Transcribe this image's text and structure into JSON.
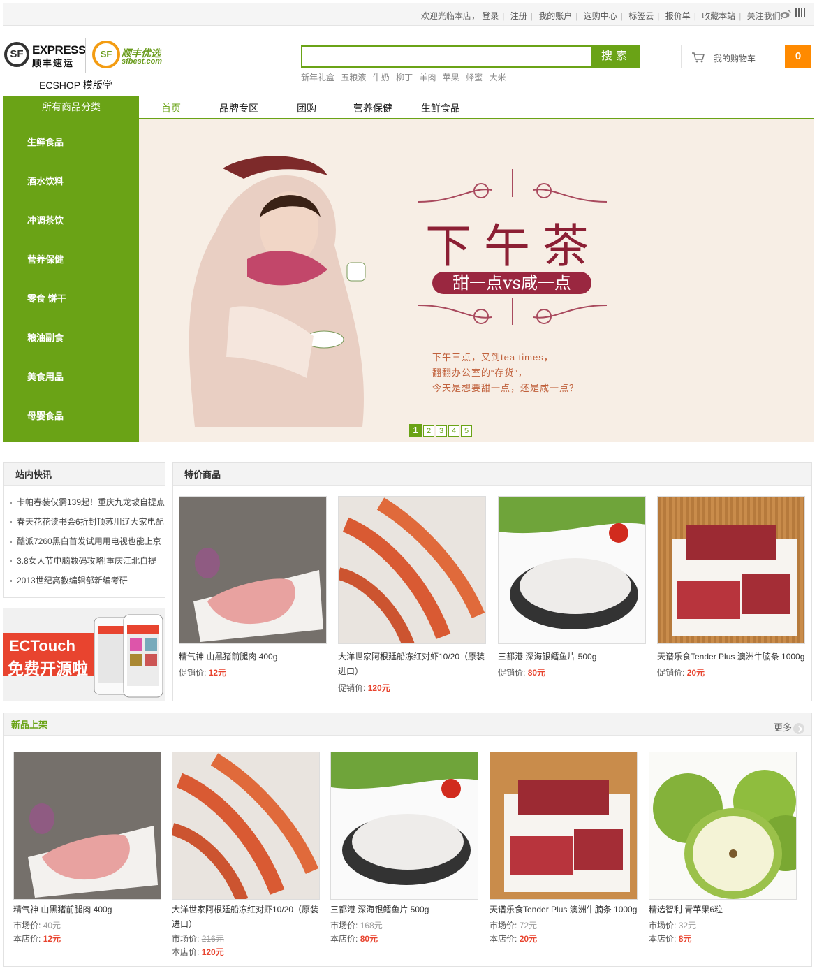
{
  "topbar": {
    "links": [
      "欢迎光临本店，",
      "登录",
      "注册",
      "我的账户",
      "选购中心",
      "标签云",
      "报价单",
      "收藏本站",
      "关注我们:"
    ]
  },
  "logo": {
    "sf": "SF",
    "express_en": "EXPRESS",
    "express_cn": "顺丰速运",
    "best_cn": "顺丰优选",
    "best_en": "sfbest.com",
    "shop_name": "ECSHOP 模版堂"
  },
  "search": {
    "button": "搜索",
    "value": "",
    "hot_words": [
      "新年礼盒",
      "五粮液",
      "牛奶",
      "柳丁",
      "羊肉",
      "苹果",
      "蜂蜜",
      "大米"
    ]
  },
  "cart": {
    "label": "我的购物车",
    "count": "0"
  },
  "nav": {
    "all_categories": "所有商品分类",
    "items": [
      "首页",
      "品牌专区",
      "团购",
      "营养保健",
      "生鲜食品"
    ]
  },
  "categories": [
    "生鲜食品",
    "酒水饮料",
    "冲调茶饮",
    "营养保健",
    "零食 饼干",
    "粮油副食",
    "美食用品",
    "母婴食品"
  ],
  "banner": {
    "title": "下午茶",
    "pill": "甜一点vs咸一点",
    "lines": [
      "下午三点，又到tea times，",
      "翻翻办公室的“存货”，",
      "今天是想要甜一点，还是咸一点？"
    ],
    "pages": [
      "1",
      "2",
      "3",
      "4",
      "5"
    ],
    "active_page": "1"
  },
  "news": {
    "title": "站内快讯",
    "items": [
      "卡帕春装仅需139起！重庆九龙坡自提点",
      "春天花花读书会6折封顶苏川辽大家电配",
      "酷派7260黑白首发试用用电视也能上京",
      "3.8女人节电脑数码攻略!重庆江北自提",
      "2013世纪高教编辑部新编考研"
    ]
  },
  "ectouch": {
    "line1": "ECTouch",
    "line2": "免费开源啦"
  },
  "special": {
    "title": "特价商品",
    "price_label": "促销价:",
    "items": [
      {
        "name": "精气神 山黑猪前腿肉 400g",
        "price": "12元"
      },
      {
        "name": "大洋世家阿根廷船冻红对虾10/20（原装进口）",
        "price": "120元"
      },
      {
        "name": "三都港 深海银鳕鱼片 500g",
        "price": "80元"
      },
      {
        "name": "天谱乐食Tender Plus 澳洲牛腩条 1000g",
        "price": "20元"
      }
    ]
  },
  "new_arrivals": {
    "title": "新品上架",
    "more": "更多",
    "market_label": "市场价:",
    "shop_label": "本店价:",
    "items": [
      {
        "name": "精气神 山黑猪前腿肉 400g",
        "market": "40元",
        "price": "12元"
      },
      {
        "name": "大洋世家阿根廷船冻红对虾10/20（原装进口）",
        "market": "216元",
        "price": "120元"
      },
      {
        "name": "三都港 深海银鳕鱼片 500g",
        "market": "168元",
        "price": "80元"
      },
      {
        "name": "天谱乐食Tender Plus 澳洲牛腩条 1000g",
        "market": "72元",
        "price": "20元"
      },
      {
        "name": "精选智利 青苹果6粒",
        "market": "32元",
        "price": "8元"
      }
    ]
  },
  "colors": {
    "accent": "#6aa316",
    "price": "#e8442f",
    "cart": "#ff8a00",
    "banner_bg": "#f7eee5"
  }
}
